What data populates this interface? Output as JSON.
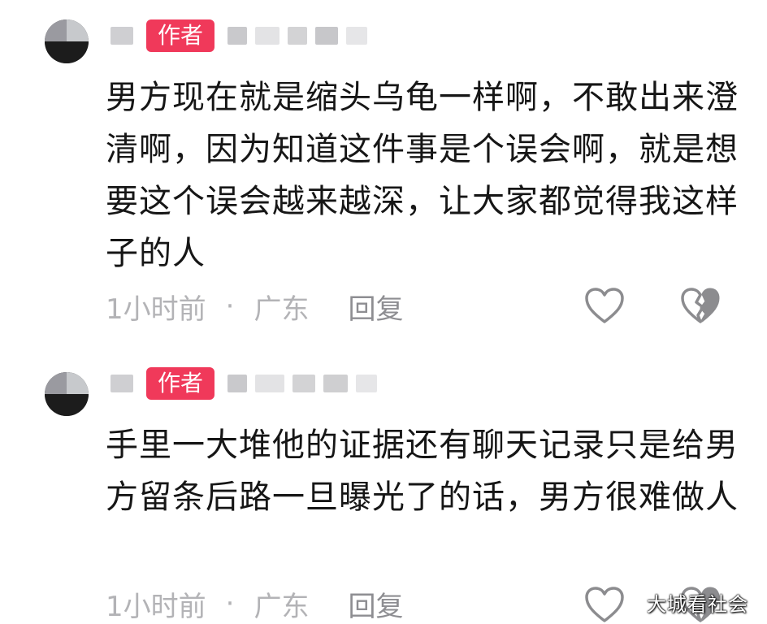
{
  "comments": [
    {
      "author_badge": "作者",
      "text": "男方现在就是缩头乌龟一样啊，不敢出来澄清啊，因为知道这件事是个误会啊，就是想要这个误会越来越深，让大家都觉得我这样子的人",
      "time": "1小时前",
      "separator": "·",
      "location": "广东",
      "reply_label": "回复",
      "like_icon": "heart-outline-icon",
      "dislike_icon": "broken-heart-icon"
    },
    {
      "author_badge": "作者",
      "text": "手里一大堆他的证据还有聊天记录只是给男方留条后路一旦曝光了的话，男方很难做人",
      "time": "1小时前",
      "separator": "·",
      "location": "广东",
      "reply_label": "回复",
      "like_icon": "heart-outline-icon",
      "dislike_icon": "broken-heart-icon"
    }
  ],
  "watermark": "大城看社会",
  "colors": {
    "badge": "#f0395a",
    "meta_text": "#b3b3b6",
    "icon_stroke": "#8c8c8f"
  }
}
